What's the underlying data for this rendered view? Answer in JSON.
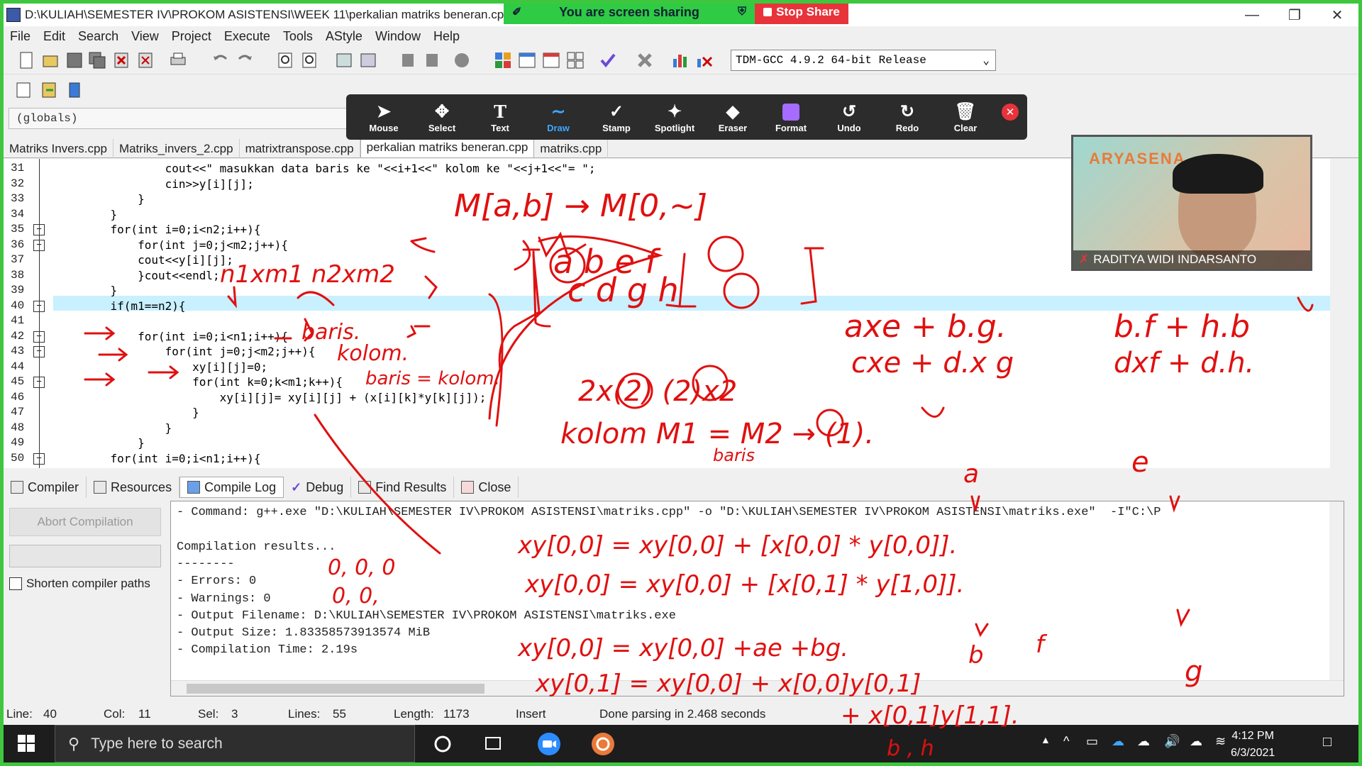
{
  "window": {
    "title": "D:\\KULIAH\\SEMESTER IV\\PROKOM ASISTENSI\\WEEK 11\\perkalian matriks beneran.cpp"
  },
  "share_banner": {
    "sharing_text": "You are screen sharing",
    "stop_label": "Stop Share"
  },
  "menu": [
    "File",
    "Edit",
    "Search",
    "View",
    "Project",
    "Execute",
    "Tools",
    "AStyle",
    "Window",
    "Help"
  ],
  "compiler": "TDM-GCC 4.9.2 64-bit Release",
  "scope": "(globals)",
  "annotate_tools": [
    {
      "label": "Mouse",
      "icon": "cursor-icon"
    },
    {
      "label": "Select",
      "icon": "move-icon"
    },
    {
      "label": "Text",
      "icon": "text-icon"
    },
    {
      "label": "Draw",
      "icon": "draw-icon"
    },
    {
      "label": "Stamp",
      "icon": "stamp-icon"
    },
    {
      "label": "Spotlight",
      "icon": "spotlight-icon"
    },
    {
      "label": "Eraser",
      "icon": "eraser-icon"
    },
    {
      "label": "Format",
      "icon": "format-icon"
    },
    {
      "label": "Undo",
      "icon": "undo-icon"
    },
    {
      "label": "Redo",
      "icon": "redo-icon"
    },
    {
      "label": "Clear",
      "icon": "trash-icon"
    }
  ],
  "file_tabs": [
    "Matriks Invers.cpp",
    "Matriks_invers_2.cpp",
    "matrixtranspose.cpp",
    "perkalian matriks beneran.cpp",
    "matriks.cpp"
  ],
  "active_tab": "perkalian matriks beneran.cpp",
  "code": {
    "lines": [
      {
        "n": "31",
        "text": "            cout<<\" masukkan data baris ke \"<<i+1<<\" kolom ke \"<<j+1<<\"= \";"
      },
      {
        "n": "32",
        "text": "            cin>>y[i][j];"
      },
      {
        "n": "33",
        "text": "        }"
      },
      {
        "n": "34",
        "text": "    }"
      },
      {
        "n": "35",
        "text": "    for(int i=0;i<n2;i++){"
      },
      {
        "n": "36",
        "text": "        for(int j=0;j<m2;j++){"
      },
      {
        "n": "37",
        "text": "        cout<<y[i][j];"
      },
      {
        "n": "38",
        "text": "        }cout<<endl;"
      },
      {
        "n": "39",
        "text": "    }"
      },
      {
        "n": "40",
        "text": "    if(m1==n2){"
      },
      {
        "n": "41",
        "text": ""
      },
      {
        "n": "42",
        "text": "        for(int i=0;i<n1;i++){"
      },
      {
        "n": "43",
        "text": "            for(int j=0;j<m2;j++){"
      },
      {
        "n": "44",
        "text": "                xy[i][j]=0;"
      },
      {
        "n": "45",
        "text": "                for(int k=0;k<m1;k++){"
      },
      {
        "n": "46",
        "text": "                    xy[i][j]= xy[i][j] + (x[i][k]*y[k][j]);"
      },
      {
        "n": "47",
        "text": "                }"
      },
      {
        "n": "48",
        "text": "            }"
      },
      {
        "n": "49",
        "text": "        }"
      },
      {
        "n": "50",
        "text": "    for(int i=0;i<n1;i++){"
      }
    ]
  },
  "bottom_tabs": [
    "Compiler",
    "Resources",
    "Compile Log",
    "Debug",
    "Find Results",
    "Close"
  ],
  "abort_label": "Abort Compilation",
  "shorten_label": "Shorten compiler paths",
  "log": [
    "- Command: g++.exe \"D:\\KULIAH\\SEMESTER IV\\PROKOM ASISTENSI\\matriks.cpp\" -o \"D:\\KULIAH\\SEMESTER IV\\PROKOM ASISTENSI\\matriks.exe\"  -I\"C:\\P",
    "",
    "Compilation results...",
    "--------",
    "- Errors: 0",
    "- Warnings: 0",
    "- Output Filename: D:\\KULIAH\\SEMESTER IV\\PROKOM ASISTENSI\\matriks.exe",
    "- Output Size: 1.83358573913574 MiB",
    "- Compilation Time: 2.19s"
  ],
  "status": {
    "line_label": "Line:",
    "line": "40",
    "col_label": "Col:",
    "col": "11",
    "sel_label": "Sel:",
    "sel": "3",
    "lines_label": "Lines:",
    "lines": "55",
    "length_label": "Length:",
    "length": "1173",
    "mode": "Insert",
    "message": "Done parsing in 2.468 seconds"
  },
  "taskbar": {
    "search_placeholder": "Type here to search",
    "time": "4:12 PM",
    "date": "6/3/2021"
  },
  "video": {
    "brand": "ARYASENA",
    "participant": "RADITYA WIDI INDARSANTO"
  },
  "ink": {
    "color": "#e01010",
    "notes": [
      "M[a,b] → M[0,~]",
      "n1xm1   n2xm2",
      "baris.",
      "kolom.",
      "baris = kolom.",
      "a  b  e  f",
      "c  d  g  h",
      "axe + b.g.",
      "b.f + h.b",
      "cxe + d.x g",
      "dxf + d.h.",
      "2x(2)  (2)x2",
      "kolom M1 = M2 → (1).",
      "baris",
      "a",
      "e",
      "xy[0,0] = xy[0,0] + [x[0,0] * y[0,0]].",
      "xy[0,0] = xy[0,0] + [x[0,1] * y[1,0]].",
      "xy[0,0] = xy[0,0] +ae +bg.",
      "xy[0,1] = xy[0,0] + x[0,0]y[0,1]",
      "+ x[0,1]y[1,1].",
      "0, 0, 0",
      "0, 0,",
      "b",
      "f",
      "g",
      "b , h"
    ]
  }
}
